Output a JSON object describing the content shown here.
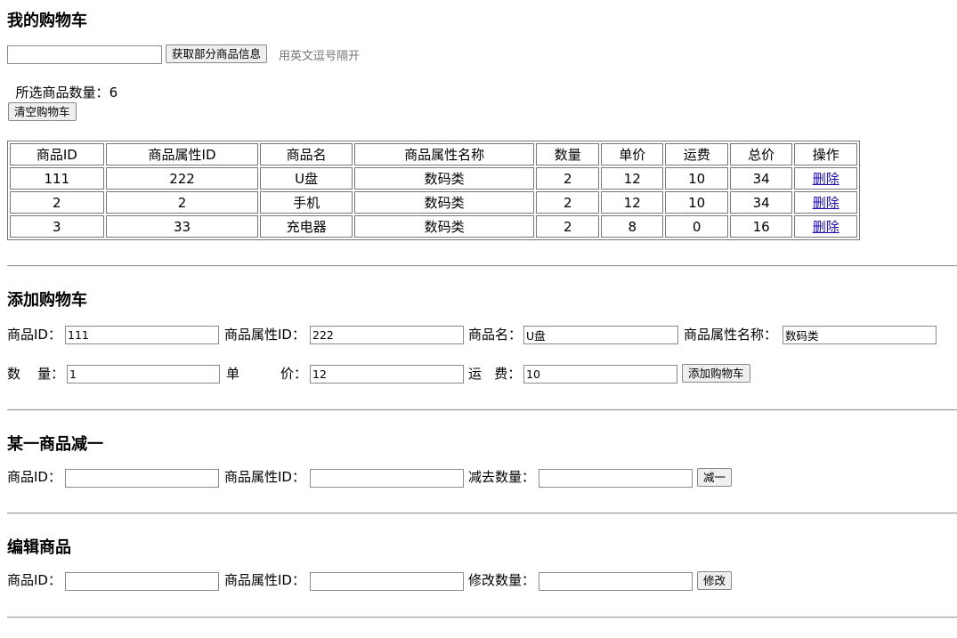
{
  "cart": {
    "title": "我的购物车",
    "fetch_button": "获取部分商品信息",
    "fetch_hint": "用英文逗号隔开",
    "selected_count_label": "所选商品数量：",
    "selected_count": "6",
    "clear_button": "清空购物车",
    "columns": [
      "商品ID",
      "商品属性ID",
      "商品名",
      "商品属性名称",
      "数量",
      "单价",
      "运费",
      "总价",
      "操作"
    ],
    "rows": [
      {
        "id": "111",
        "attr_id": "222",
        "name": "U盘",
        "attr_name": "数码类",
        "qty": "2",
        "price": "12",
        "freight": "10",
        "total": "34",
        "action": "删除"
      },
      {
        "id": "2",
        "attr_id": "2",
        "name": "手机",
        "attr_name": "数码类",
        "qty": "2",
        "price": "12",
        "freight": "10",
        "total": "34",
        "action": "删除"
      },
      {
        "id": "3",
        "attr_id": "33",
        "name": "充电器",
        "attr_name": "数码类",
        "qty": "2",
        "price": "8",
        "freight": "0",
        "total": "16",
        "action": "删除"
      }
    ]
  },
  "add": {
    "title": "添加购物车",
    "id_label": "商品ID：",
    "id_value": "111",
    "attr_id_label": "商品属性ID：",
    "attr_id_value": "222",
    "name_label": "商品名：",
    "name_value": "U盘",
    "attr_name_label": "商品属性名称：",
    "attr_name_value": "数码类",
    "qty_label": "数    量：",
    "qty_value": "1",
    "price_label_1": "单",
    "price_label_2": "价：",
    "price_value": "12",
    "freight_label": "运   费：",
    "freight_value": "10",
    "submit_button": "添加购物车"
  },
  "reduce": {
    "title": "某一商品减一",
    "id_label": "商品ID：",
    "attr_id_label": "商品属性ID：",
    "qty_label": "减去数量：",
    "submit_button": "减一"
  },
  "edit": {
    "title": "编辑商品",
    "id_label": "商品ID：",
    "attr_id_label": "商品属性ID：",
    "qty_label": "修改数量：",
    "submit_button": "修改"
  }
}
